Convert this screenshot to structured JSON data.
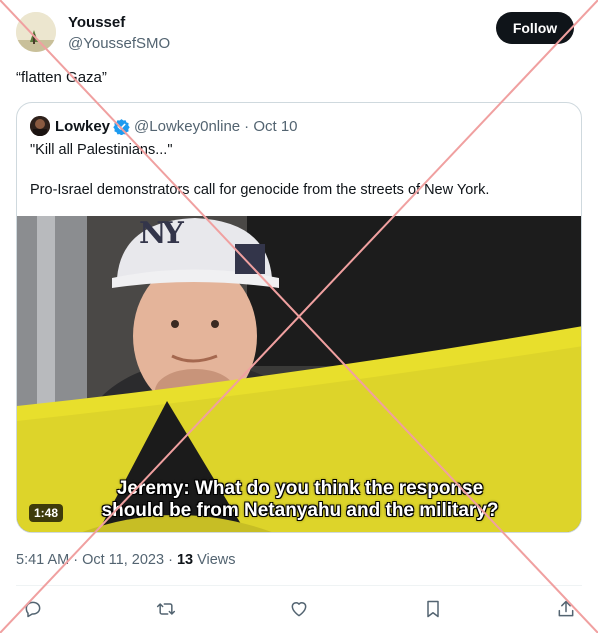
{
  "tweet": {
    "author_name": "Youssef",
    "author_handle": "@YoussefSMO",
    "follow_label": "Follow",
    "text": "“flatten Gaza”",
    "timestamp": "5:41 AM · Oct 11, 2023 · ",
    "views_count": "13",
    "views_label": " Views"
  },
  "quote": {
    "author_name": "Lowkey",
    "author_handle": "@Lowkey0nline",
    "date": "· Oct 10",
    "line1": "\"Kill all Palestinians...\"",
    "line2": "Pro-Israel demonstrators call for genocide from the streets of New York.",
    "video": {
      "duration": "1:48",
      "subtitle_line1": "Jeremy: What do you think the response",
      "subtitle_line2": "should be from Netanyahu and the military?",
      "cap_logo": "NY"
    }
  },
  "icons": {
    "reply": "reply-icon",
    "retweet": "retweet-icon",
    "like": "like-icon",
    "bookmark": "bookmark-icon",
    "share": "share-icon",
    "verified": "verified-badge-icon"
  },
  "colors": {
    "follow_bg": "#0f1419",
    "verified": "#1d9bf0",
    "cross_overlay": "#f0a0a0",
    "muted_text": "#536471"
  }
}
